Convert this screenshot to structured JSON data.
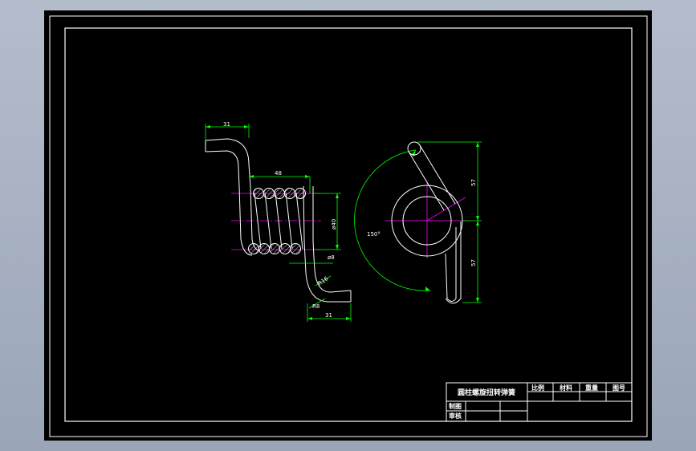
{
  "drawing": {
    "dimensions": {
      "top_arm_length": "31",
      "coil_length": "48",
      "coil_diameter": "ø40",
      "wire_diameter": "ø8",
      "bend_radius_1": "R16",
      "bend_radius_2": "R8",
      "bottom_arm_length": "31",
      "upper_leg_height": "57",
      "lower_leg_height": "57",
      "leg_angle": "150°"
    },
    "colors": {
      "background": "#000000",
      "geometry": "#ffffff",
      "dimension": "#00ff00",
      "centerline": "#ff00ff",
      "hatch": "#ffffff"
    }
  },
  "title_block": {
    "title": "圆柱螺旋扭转弹簧",
    "headers": [
      "比例",
      "材料",
      "重量",
      "图号"
    ],
    "rows": [
      "制图",
      "审核"
    ]
  }
}
